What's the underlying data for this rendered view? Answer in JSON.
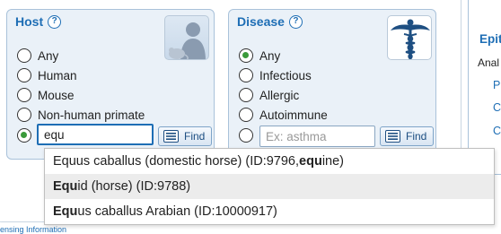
{
  "host": {
    "title": "Host",
    "help": "?",
    "options": [
      "Any",
      "Human",
      "Mouse",
      "Non-human primate"
    ],
    "selected_index": 4,
    "input_value": "equ",
    "find_label": "Find"
  },
  "disease": {
    "title": "Disease",
    "help": "?",
    "options": [
      "Any",
      "Infectious",
      "Allergic",
      "Autoimmune"
    ],
    "selected_index": 0,
    "input_placeholder": "Ex: asthma",
    "find_label": "Find"
  },
  "autocomplete": {
    "items": [
      {
        "pre": "Equus caballus (domestic horse) (ID:9796, ",
        "bold": "equ",
        "post": "ine)"
      },
      {
        "pre": "",
        "bold": "Equ",
        "post": "id (horse) (ID:9788)"
      },
      {
        "pre": "",
        "bold": "Equ",
        "post": "us caballus Arabian (ID:10000917)"
      }
    ],
    "hover_index": 1
  },
  "right_panel": {
    "title": "Epit",
    "subtitle": "Anal",
    "links": [
      "P",
      "C",
      "C"
    ]
  },
  "footer": {
    "link": "ensing Information"
  },
  "colors": {
    "accent": "#1e6eb5",
    "panel_bg": "#eaf1f8",
    "radio_selected": "#3a9a3a"
  }
}
